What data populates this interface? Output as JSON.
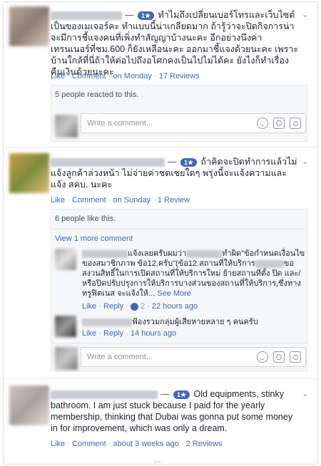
{
  "posts": [
    {
      "badge": "1★",
      "text": "ทำไมถึงเปลี่ยนเบอร์โทรและเว็บไซต์เป็นของเมเจอร์คะ ทำแบบนี้น่าเกลียดมาก ถ้ารู้ว่าจะปิดกิจการน่าจะมีการชี้แจงคนที่เพิ่งทำสัญญาบ้างนะคะ อีกอย่างนึงค่าเทรนเนอร์ที่ชม.600 ก็ยังเหลือนะคะ ออกมาชี้แจงด้วยนะคะ เพราะบ้านใกล้ที่นี่ถ้าให้ต่อไปถึงอโศกคงเป็นไปไม่ได้คะ ยังไงก็ทำเรื่องคืนเงินด้วยนะคะ",
      "like": "Like",
      "comment": "Comment",
      "time": "on Monday",
      "reviews": "17 Reviews",
      "reactions": "5 people reacted to this.",
      "comment_placeholder": "Write a comment..."
    },
    {
      "badge": "1★",
      "text": "ถ้าคิดจะปิดทำการแล้วไม่แจ้งลูกค้าล่วงหน้า ไม่จ่ายค่าชดเชยใดๆ พรุ่งนี้จะแจ้งความและแจ้ง สคบ. นะคะ",
      "like": "Like",
      "comment": "Comment",
      "time": "on Sunday",
      "reviews": "1 Review",
      "reactions": "6 people like this.",
      "view_more": "View 1 more comment",
      "replies": [
        {
          "text_a": "แจ้งเลยครับผมว่า",
          "text_b": "ทำผิด\"ข้อกำหนดเงื่อนไขของสมาชิกภาพ ข้อ12.ครับ\"(ข้อ12.สถานที่ให้บริการ",
          "text_c": "ขอสงวนสิทธิ์ในการเปิดสถานที่ให้บริการใหม่ ย้ายสถานที่ตั้ง ปิด และ/หรือปิดปรับปรุงการให้บริการบางส่วนของสถานที่ให้บริการ,ซึ่งทาง ทรูฟิตเนส จะแจ้งให้...",
          "see_more": "See More",
          "like": "Like",
          "reply": "Reply",
          "count": "2",
          "time": "22 hours ago"
        },
        {
          "text": "ฟ้องรวมกลุ่มผู้เสียหายหลาย ๆ คนครับ",
          "like": "Like",
          "reply": "Reply",
          "time": "14 hours ago"
        }
      ],
      "comment_placeholder": "Write a comment..."
    },
    {
      "badge": "1★",
      "text": "Old equipments, stinky bathroom. I am just stuck because I paid for the yearly membership, thinking that Dubai was gonna put some money in for improvement, which was only a dream.",
      "like": "Like",
      "comment": "Comment",
      "time": "about 3 weeks ago",
      "reviews": "2 Reviews"
    }
  ],
  "separator": "—",
  "dot": "·",
  "chevron": "⌄",
  "footer_mark": "***",
  "colors": {
    "link": "#4267b2",
    "meta": "#90949c",
    "badge": "#4267b2"
  }
}
